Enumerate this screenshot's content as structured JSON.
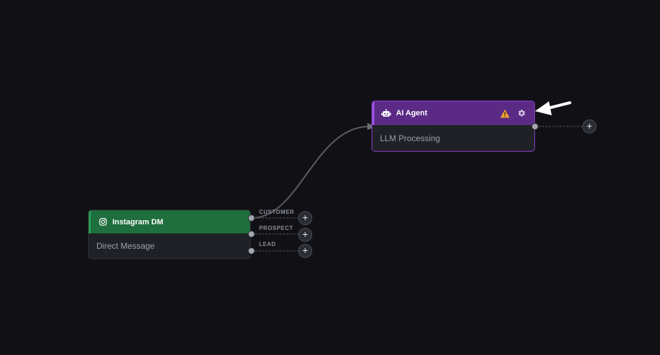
{
  "nodes": {
    "instagram": {
      "title": "Instagram DM",
      "subtitle": "Direct Message",
      "icon": "instagram-icon",
      "outputs": [
        {
          "label": "CUSTOMER"
        },
        {
          "label": "PROSPECT"
        },
        {
          "label": "LEAD"
        }
      ]
    },
    "ai_agent": {
      "title": "AI Agent",
      "subtitle": "LLM Processing",
      "icon": "robot-icon",
      "status_icon": "warning-icon",
      "settings_icon": "gear-icon"
    }
  },
  "add_button_label": "+",
  "colors": {
    "canvas_bg": "#111115",
    "instagram_header": "#1f6e3d",
    "ai_header": "#5a2a85",
    "ai_border": "#8a3fd1",
    "warning": "#f0a030"
  }
}
